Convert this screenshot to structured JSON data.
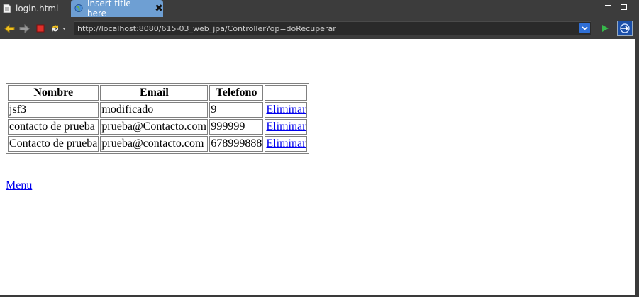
{
  "tabs": [
    {
      "label": "login.html",
      "icon": "document-icon",
      "active": false
    },
    {
      "label": "Insert title here",
      "icon": "globe-icon",
      "active": true
    }
  ],
  "toolbar": {
    "url": "http://localhost:8080/615-03_web_jpa/Controller?op=doRecuperar"
  },
  "table": {
    "headers": [
      "Nombre",
      "Email",
      "Telefono",
      ""
    ],
    "rows": [
      {
        "nombre": "jsf3",
        "email": "modificado",
        "telefono": "9",
        "action": "Eliminar"
      },
      {
        "nombre": "contacto de prueba",
        "email": "prueba@Contacto.com",
        "telefono": "999999",
        "action": "Eliminar"
      },
      {
        "nombre": "Contacto de prueba",
        "email": "prueba@contacto.com",
        "telefono": "678999888",
        "action": "Eliminar"
      }
    ]
  },
  "menu_link": "Menu",
  "colors": {
    "active_tab": "#6e9fd3",
    "link": "#0000ee"
  }
}
